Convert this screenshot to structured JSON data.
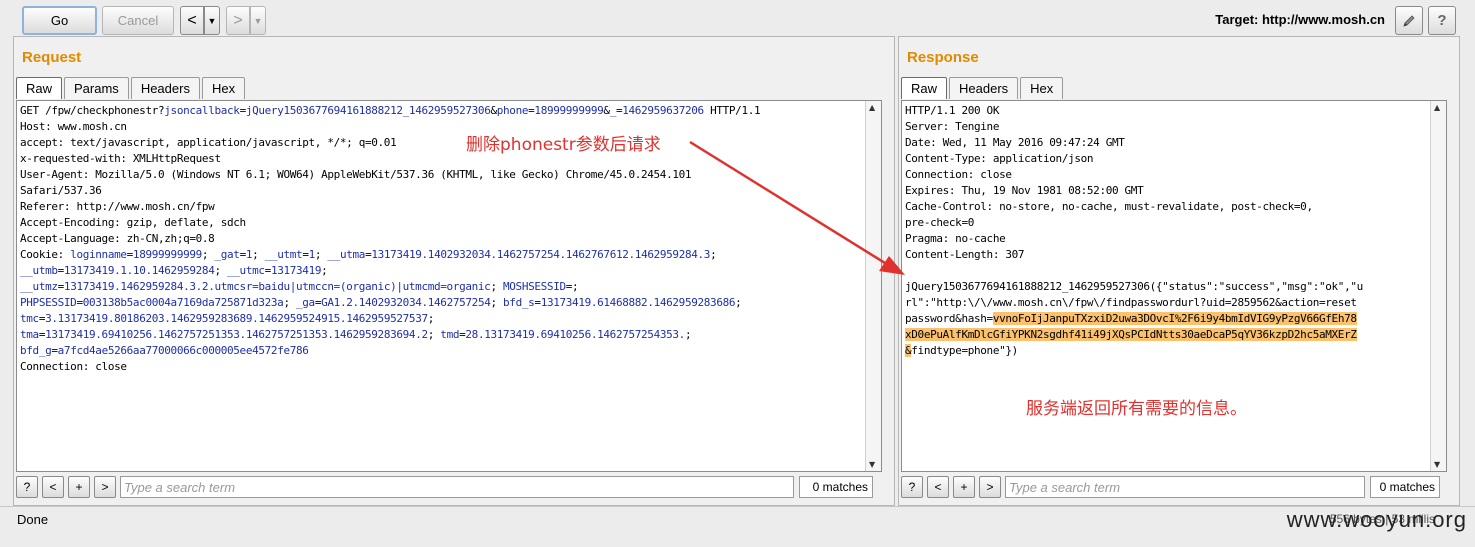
{
  "toolbar": {
    "go_label": "Go",
    "cancel_label": "Cancel",
    "back_glyph": "<",
    "back_dropdown_glyph": "▼",
    "forward_glyph": ">",
    "forward_dropdown_glyph": "▼",
    "target_label": "Target: http://www.mosh.cn",
    "edit_icon": "pencil-icon",
    "help_glyph": "?"
  },
  "request": {
    "title": "Request",
    "tabs": [
      {
        "label": "Raw"
      },
      {
        "label": "Params"
      },
      {
        "label": "Headers"
      },
      {
        "label": "Hex"
      }
    ],
    "active_tab": "Raw",
    "search": {
      "help": "?",
      "prev": "<",
      "add": "+",
      "next": ">",
      "placeholder": "Type a search term",
      "matches": "0 matches"
    }
  },
  "response": {
    "title": "Response",
    "tabs": [
      {
        "label": "Raw"
      },
      {
        "label": "Headers"
      },
      {
        "label": "Hex"
      }
    ],
    "active_tab": "Raw",
    "search": {
      "help": "?",
      "prev": "<",
      "add": "+",
      "next": ">",
      "placeholder": "Type a search term",
      "matches": "0 matches"
    }
  },
  "annotations": {
    "request_note": "删除phonestr参数后请求",
    "response_note": "服务端返回所有需要的信息。"
  },
  "status": {
    "text": "Done",
    "right": "556 bytes | 53 millis",
    "watermark": "www.wooyun.org"
  },
  "colors": {
    "param": "#1e2fa8",
    "highlight": "#fbc16c",
    "annotation": "#e0312e",
    "title": "#e08a00"
  }
}
